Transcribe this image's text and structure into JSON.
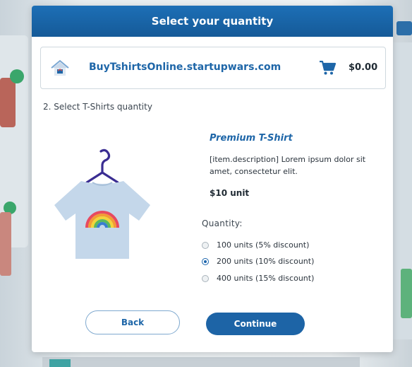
{
  "dialog": {
    "title": "Select your quantity"
  },
  "store": {
    "name": "BuyTshirtsOnline.startupwars.com",
    "cart_total": "$0.00",
    "logo_icon": "store-logo-icon",
    "cart_icon": "shopping-cart-icon"
  },
  "step": {
    "title": "2. Select T-Shirts quantity"
  },
  "product": {
    "name": "Premium T-Shirt",
    "description": "[item.description] Lorem ipsum dolor sit amet, consectetur elit.",
    "price": "$10 unit",
    "image_icon": "tshirt-rainbow-image"
  },
  "quantity": {
    "label": "Quantity:",
    "options": [
      {
        "label": "100 units (5% discount)",
        "selected": false
      },
      {
        "label": "200 units (10% discount)",
        "selected": true
      },
      {
        "label": "400 units (15% discount)",
        "selected": false
      }
    ]
  },
  "buttons": {
    "back": "Back",
    "continue": "Continue"
  },
  "colors": {
    "accent": "#1d64a6",
    "header": "#1d6fb6",
    "link": "#1e66a8"
  }
}
